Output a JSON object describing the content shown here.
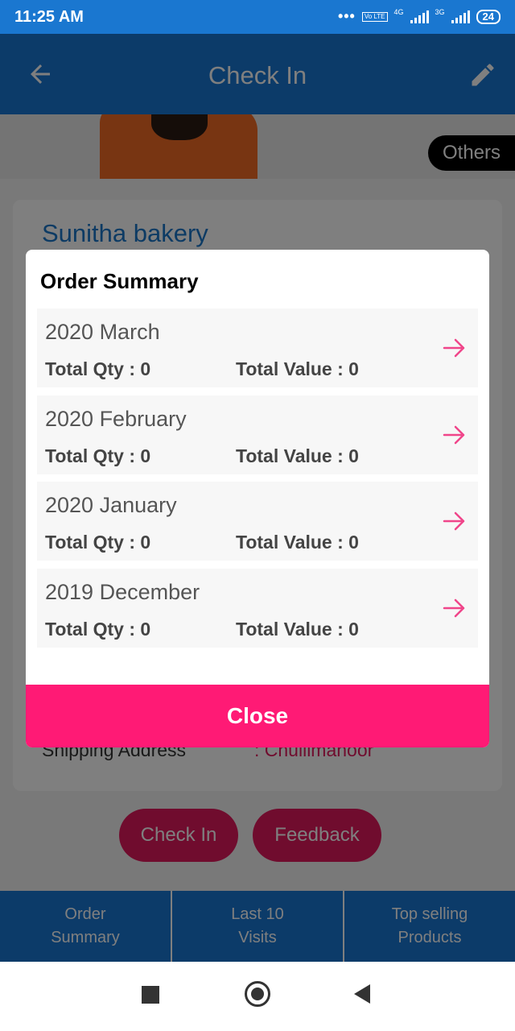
{
  "status_bar": {
    "time": "11:25 AM",
    "dots": "•••",
    "volte": "Vo LTE",
    "net1": "4G",
    "net2": "3G",
    "battery": "24"
  },
  "app_bar": {
    "title": "Check In"
  },
  "banner": {
    "chip": "Others"
  },
  "shop": {
    "name": "Sunitha bakery"
  },
  "shipping": {
    "label": "Shipping Address",
    "value": ": Chullimanoor"
  },
  "actions": {
    "check_in": "Check In",
    "feedback": "Feedback"
  },
  "tabs": [
    {
      "line1": "Order",
      "line2": "Summary"
    },
    {
      "line1": "Last 10",
      "line2": "Visits"
    },
    {
      "line1": "Top selling",
      "line2": "Products"
    }
  ],
  "dialog": {
    "title": "Order Summary",
    "items": [
      {
        "month": "2020 March",
        "qty": "Total Qty : 0",
        "value": "Total Value : 0"
      },
      {
        "month": "2020 February",
        "qty": "Total Qty : 0",
        "value": "Total Value : 0"
      },
      {
        "month": "2020 January",
        "qty": "Total Qty : 0",
        "value": "Total Value : 0"
      },
      {
        "month": "2019 December",
        "qty": "Total Qty : 0",
        "value": "Total Value : 0"
      }
    ],
    "close_label": "Close"
  },
  "colors": {
    "primary": "#1976d2",
    "accent": "#ff1a75",
    "arrow": "#f0458a"
  }
}
